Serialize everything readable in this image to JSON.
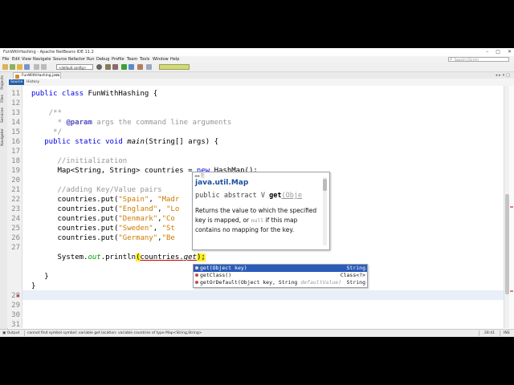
{
  "window": {
    "title": "FunWithHashing - Apache NetBeans IDE 11.2"
  },
  "menu": [
    "File",
    "Edit",
    "View",
    "Navigate",
    "Source",
    "Refactor",
    "Run",
    "Debug",
    "Profile",
    "Team",
    "Tools",
    "Window",
    "Help"
  ],
  "search": {
    "placeholder": "Search (Ctrl+I)"
  },
  "toolbar": {
    "config": "<default config>",
    "memory": ""
  },
  "side_tabs": [
    "Projects",
    "Files",
    "Services",
    "Navigator"
  ],
  "editor_tab": {
    "filename": "FunWithHashing.java"
  },
  "editor_toolbar": {
    "source": "Source",
    "history": "History"
  },
  "code": {
    "l11": "public class FunWithHashing {",
    "l12": "    /**",
    "l13_tag": "@param",
    "l13_rest": " args the command line arguments",
    "l14": "     */",
    "l15a": "public static void ",
    "l15b": "main",
    "l15c": "(String[] args) {",
    "l17": "//initialization",
    "l18a": "Map<String, String> countries = ",
    "l18b": "new",
    "l18c": " HashMap();",
    "l20": "//adding Key/Value pairs",
    "puts": [
      {
        "pre": "countries.put(",
        "s1": "\"Spain\"",
        "mid": ", ",
        "s2": "\"Madr"
      },
      {
        "pre": "countries.put(",
        "s1": "\"England\"",
        "mid": ", ",
        "s2": "\"Lo"
      },
      {
        "pre": "countries.put(",
        "s1": "\"Denmark\"",
        "mid": ",",
        "s2": "\"Co"
      },
      {
        "pre": "countries.put(",
        "s1": "\"Sweden\"",
        "mid": ", ",
        "s2": "\"St"
      },
      {
        "pre": "countries.put(",
        "s1": "\"Germany\"",
        "mid": ",",
        "s2": "\"Be"
      }
    ],
    "l28a": "System.",
    "l28b": "out",
    "l28c": ".println",
    "l28d": "(",
    "l28e": "countries.",
    "l28f": "get",
    "l28g": ");",
    "l30": "}",
    "l31": "}"
  },
  "javadoc": {
    "package": "java.util.Map",
    "signature_pre": "public abstract V ",
    "method": "get",
    "param": "(Obje",
    "desc_1": "Returns the value to which the specified key is mapped, or ",
    "code": "null",
    "desc_2": " if this map contains no mapping for the key."
  },
  "completion": [
    {
      "name": "get(Object key)",
      "type": "String",
      "selected": true
    },
    {
      "name": "getClass()",
      "type": "Class<?>",
      "selected": false
    },
    {
      "name": "getOrDefault(Object key, String ",
      "param": "defaultValue)",
      "type": "String",
      "selected": false
    }
  ],
  "status": {
    "left": "Output",
    "msg": "cannot find symbol    symbol:   variable get   location: variable countries of type Map<String,String>",
    "pos": "28:41",
    "mode": "INS"
  }
}
